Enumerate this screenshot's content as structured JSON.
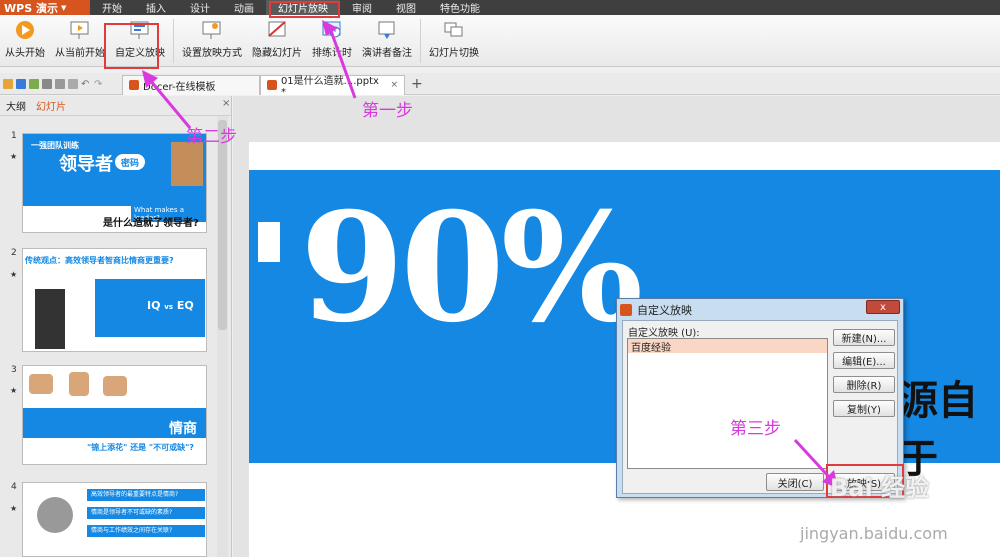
{
  "app": {
    "logo": "WPS 演示"
  },
  "menu": [
    "开始",
    "插入",
    "设计",
    "动画",
    "幻灯片放映",
    "审阅",
    "视图",
    "特色功能"
  ],
  "ribbon": {
    "buttons": [
      "从头开始",
      "从当前开始",
      "自定义放映",
      "设置放映方式",
      "隐藏幻灯片",
      "排练计时",
      "演讲者备注",
      "幻灯片切换"
    ]
  },
  "tabs": {
    "doc1": "Docer-在线模板",
    "doc2": "01是什么造就....pptx *",
    "add": "+"
  },
  "panel": {
    "tab_outline": "大纲",
    "tab_slides": "幻灯片"
  },
  "slides": [
    {
      "num": "1",
      "small_title": "一强团队训练",
      "title": "领导者",
      "badge": "密码",
      "question_en": "What makes a leader?",
      "question": "是什么造就了领导者?"
    },
    {
      "num": "2",
      "title": "传统观点：高效领导者智商比情商更重要?",
      "iq": "IQ",
      "vs": "vs",
      "eq": "EQ"
    },
    {
      "num": "3",
      "box": "情商",
      "caption": "\"锦上添花\" 还是 \"不可或缺\"?"
    },
    {
      "num": "4",
      "c1": "高效领导者的最重要特点是情商?",
      "c2": "情商是领导者不可或缺的素质?",
      "c3": "情商与工作绩效之间存在关联?"
    }
  ],
  "slide_main": {
    "big": "90%",
    "side": "源自于"
  },
  "dialog": {
    "title": "自定义放映",
    "close": "x",
    "list_label": "自定义放映 (U):",
    "list_items": [
      "百度经验"
    ],
    "btn_new": "新建(N)...",
    "btn_edit": "编辑(E)...",
    "btn_delete": "删除(R)",
    "btn_copy": "复制(Y)",
    "btn_close": "关闭(C)",
    "btn_show": "放映(S)"
  },
  "annotations": {
    "step1": "第一步",
    "step2": "第二步",
    "step3": "第三步"
  },
  "watermark": {
    "main": "Bai 经验",
    "url": "jingyan.baidu.com"
  },
  "colors": {
    "accent": "#d8541e",
    "slide_blue": "#1488e3",
    "annotation": "#d93adf",
    "highlight": "#e23b3b"
  }
}
